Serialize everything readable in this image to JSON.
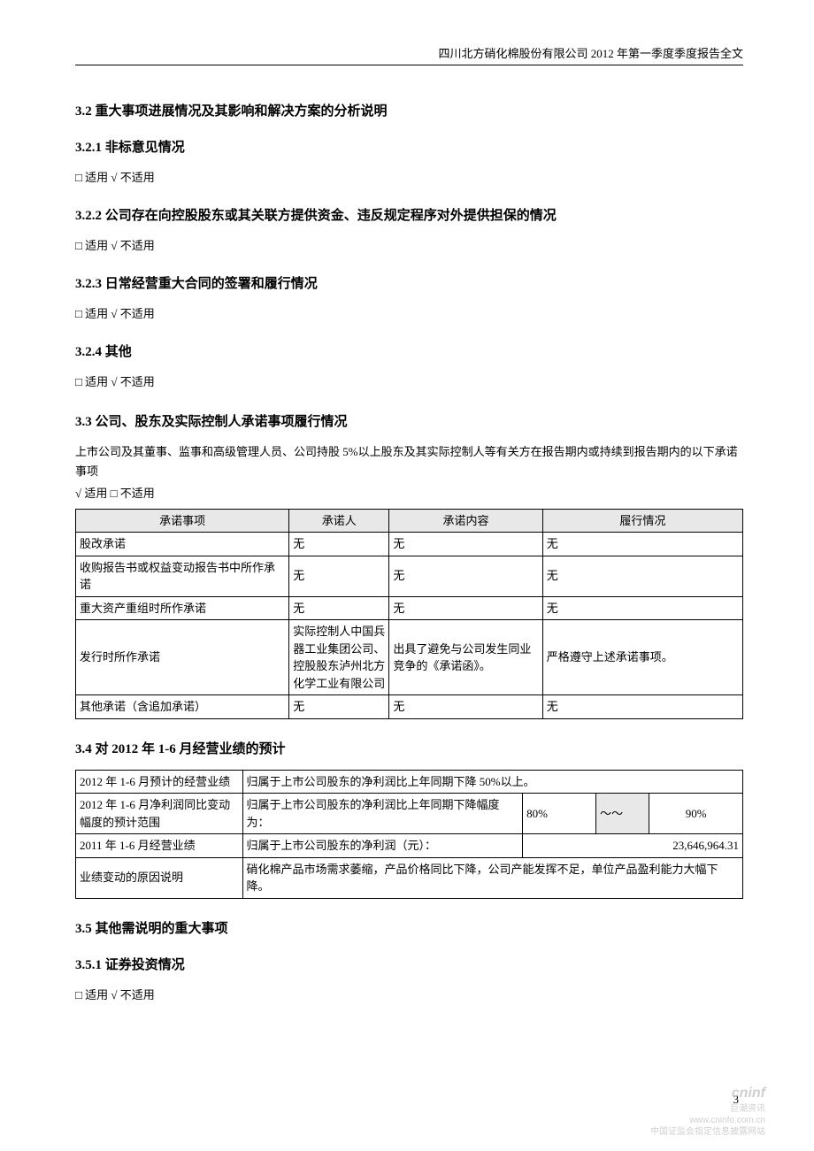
{
  "header": "四川北方硝化棉股份有限公司 2012 年第一季度季度报告全文",
  "s32": "3.2 重大事项进展情况及其影响和解决方案的分析说明",
  "s321": "3.2.1 非标意见情况",
  "na1": "□ 适用 √ 不适用",
  "s322": "3.2.2 公司存在向控股股东或其关联方提供资金、违反规定程序对外提供担保的情况",
  "na2": "□ 适用 √ 不适用",
  "s323": "3.2.3 日常经营重大合同的签署和履行情况",
  "na3": "□ 适用 √ 不适用",
  "s324": "3.2.4 其他",
  "na4": "□ 适用 √ 不适用",
  "s33": "3.3 公司、股东及实际控制人承诺事项履行情况",
  "s33_intro": "上市公司及其董事、监事和高级管理人员、公司持股 5%以上股东及其实际控制人等有关方在报告期内或持续到报告期内的以下承诺事项",
  "s33_apply": "√ 适用 □ 不适用",
  "tbl1": {
    "h": [
      "承诺事项",
      "承诺人",
      "承诺内容",
      "履行情况"
    ],
    "r": [
      [
        "股改承诺",
        "无",
        "无",
        "无"
      ],
      [
        "收购报告书或权益变动报告书中所作承诺",
        "无",
        "无",
        "无"
      ],
      [
        "重大资产重组时所作承诺",
        "无",
        "无",
        "无"
      ],
      [
        "发行时所作承诺",
        "实际控制人中国兵器工业集团公司、控股股东泸州北方化学工业有限公司",
        "出具了避免与公司发生同业竞争的《承诺函》。",
        "严格遵守上述承诺事项。"
      ],
      [
        "其他承诺（含追加承诺）",
        "无",
        "无",
        "无"
      ]
    ]
  },
  "s34": "3.4 对 2012 年 1-6 月经营业绩的预计",
  "tbl2": {
    "r1a": "2012 年 1-6 月预计的经营业绩",
    "r1b": "归属于上市公司股东的净利润比上年同期下降 50%以上。",
    "r2a": "2012 年 1-6 月净利润同比变动幅度的预计范围",
    "r2b": "归属于上市公司股东的净利润比上年同期下降幅度为：",
    "r2c": "80%",
    "r2d": "～～",
    "r2e": "90%",
    "r3a": "2011 年 1-6 月经营业绩",
    "r3b": "归属于上市公司股东的净利润（元）：",
    "r3c": "23,646,964.31",
    "r4a": "业绩变动的原因说明",
    "r4b": "硝化棉产品市场需求萎缩，产品价格同比下降，公司产能发挥不足，单位产品盈利能力大幅下降。"
  },
  "s35": "3.5 其他需说明的重大事项",
  "s351": "3.5.1 证券投资情况",
  "na5": "□ 适用 √ 不适用",
  "page": "3",
  "wm": {
    "l1": "cninf",
    "l2": "巨潮资讯",
    "l3": "www.cninfo.com.cn",
    "l4": "中国证监会指定信息披露网站"
  }
}
